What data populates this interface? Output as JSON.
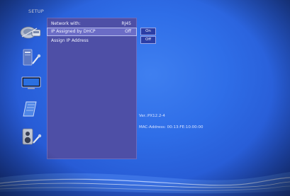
{
  "title": "SETUP",
  "sidebar": {
    "icons": [
      {
        "name": "network-icon"
      },
      {
        "name": "system-settings-icon"
      },
      {
        "name": "display-icon"
      },
      {
        "name": "media-icon"
      },
      {
        "name": "audio-icon"
      }
    ]
  },
  "menu": {
    "items": [
      {
        "label": "Network with:",
        "value": "RJ45"
      },
      {
        "label": "IP Assigned by DHCP",
        "value": "Off"
      },
      {
        "label": "Assign IP Address",
        "value": ""
      }
    ]
  },
  "options": [
    "On",
    "Off"
  ],
  "info": {
    "version": "Ver.:PX12.2-4",
    "mac": "MAC-Address: 00:13:FE:10:00:00"
  },
  "colors": {
    "background": "#2f6ee8",
    "panel": "#4e4fa6",
    "selected_row": "#6b6cc6",
    "option_box": "#2b3ea6"
  }
}
